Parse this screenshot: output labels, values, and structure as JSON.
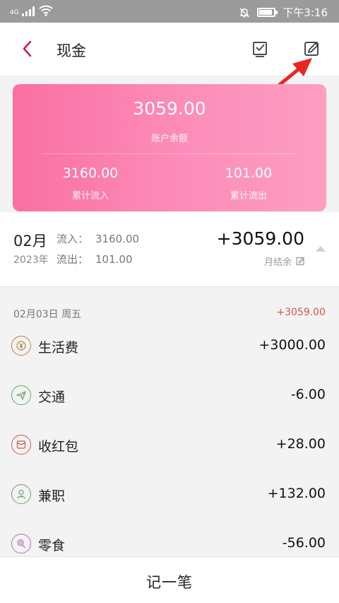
{
  "statusbar": {
    "network": "4G",
    "time": "下午3:16"
  },
  "navbar": {
    "title": "现金",
    "icons": [
      "back-chevron-icon",
      "checklist-icon",
      "edit-pencil-icon"
    ]
  },
  "account_card": {
    "balance": "3059.00",
    "balance_label": "账户余额",
    "inflow": "3160.00",
    "inflow_label": "累计流入",
    "outflow": "101.00",
    "outflow_label": "累计流出"
  },
  "month_summary": {
    "month": "02月",
    "year": "2023年",
    "inflow_label": "流入：",
    "inflow_value": "3160.00",
    "outflow_label": "流出：",
    "outflow_value": "101.00",
    "total": "+3059.00",
    "total_label": "月结余"
  },
  "transactions": {
    "date": "02月03日 周五",
    "date_total": "+3059.00",
    "items": [
      {
        "name": "生活费",
        "amount": "+3000.00",
        "icon": "yen-icon",
        "color": "#b8863e"
      },
      {
        "name": "交通",
        "amount": "-6.00",
        "icon": "paper-plane-icon",
        "color": "#6aa56a"
      },
      {
        "name": "收红包",
        "amount": "+28.00",
        "icon": "red-envelope-icon",
        "color": "#c85a4b"
      },
      {
        "name": "兼职",
        "amount": "+132.00",
        "icon": "person-icon",
        "color": "#6aa56a"
      },
      {
        "name": "零食",
        "amount": "-56.00",
        "icon": "lollipop-icon",
        "color": "#b56fb5"
      }
    ]
  },
  "bottom_button": {
    "label": "记一笔"
  },
  "colors": {
    "accent": "#c2185b",
    "card_start": "#fa6fa3",
    "card_end": "#fd9ec3",
    "arrow": "#e8271f",
    "positive_day_total": "#d9534f"
  }
}
